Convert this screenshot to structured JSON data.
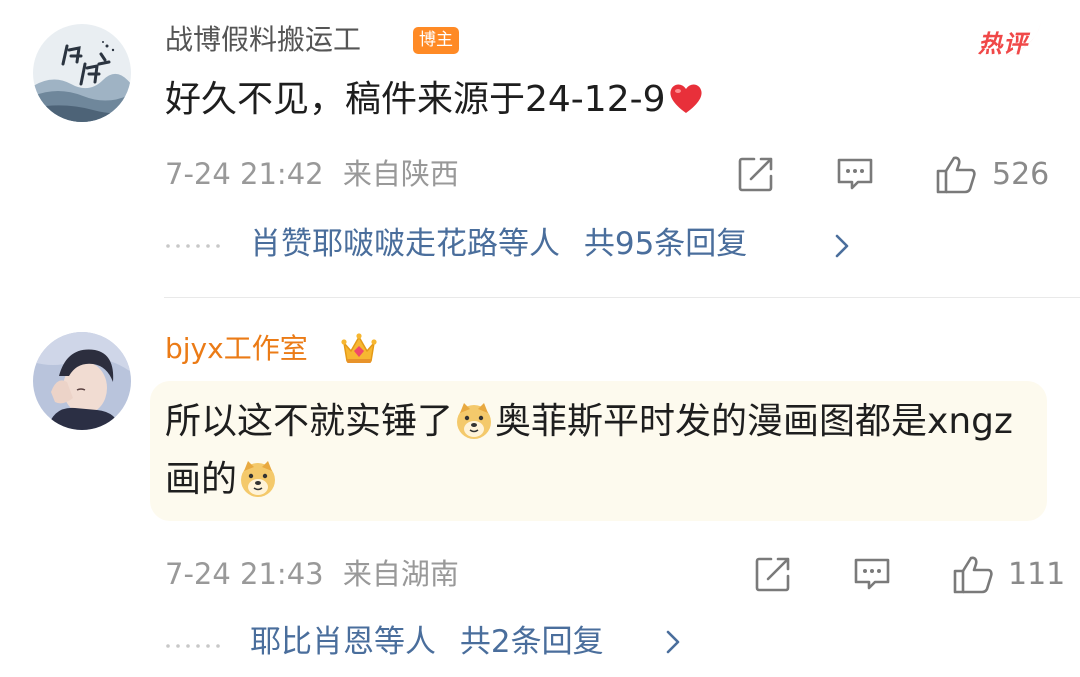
{
  "comments": [
    {
      "username": "战博假料搬运工",
      "badge": "博主",
      "hot_tag": "热评",
      "text": "好久不见，稿件来源于24-12-9",
      "emoji": "heart-emoji",
      "time": "7-24 21:42",
      "location": "来自陕西",
      "likes": "526",
      "reply_names": "肖赞耶啵啵走花路等人",
      "reply_count": "共95条回复"
    },
    {
      "username": "bjyx工作室",
      "badge_icon": "crown-icon",
      "text_parts": [
        "所以这不就实锤了",
        "奥菲斯平时发的漫画图都是xngz画的"
      ],
      "emoji": "doge-emoji",
      "time": "7-24 21:43",
      "location": "来自湖南",
      "likes": "111",
      "reply_names": "耶比肖恩等人",
      "reply_count": "共2条回复"
    }
  ],
  "colors": {
    "username_vip": "#eb7b16",
    "badge_bg": "#ff8a25",
    "hot": "#f04848",
    "reply_link": "#4a6e9c",
    "meta": "#999999",
    "bubble_bg": "#fdfaee"
  }
}
